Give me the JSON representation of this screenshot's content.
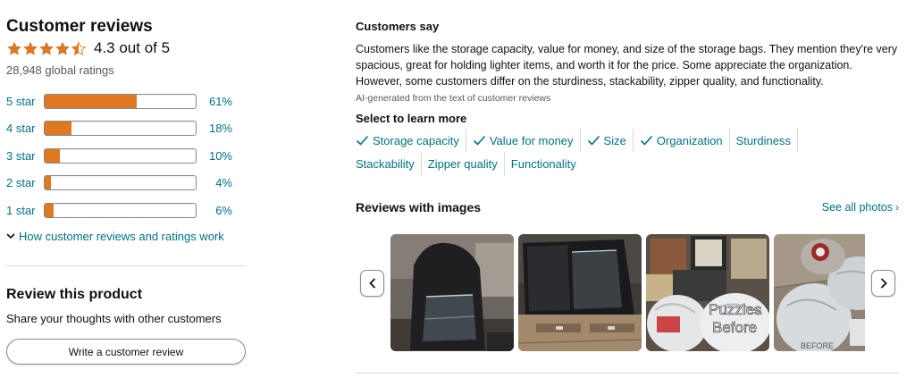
{
  "reviews": {
    "title": "Customer reviews",
    "rating_value": 4.3,
    "rating_text": "4.3 out of 5",
    "global_ratings": "28,948 global ratings",
    "histogram": [
      {
        "label": "5 star",
        "percent": 61,
        "percent_text": "61%"
      },
      {
        "label": "4 star",
        "percent": 18,
        "percent_text": "18%"
      },
      {
        "label": "3 star",
        "percent": 10,
        "percent_text": "10%"
      },
      {
        "label": "2 star",
        "percent": 4,
        "percent_text": "4%"
      },
      {
        "label": "1 star",
        "percent": 6,
        "percent_text": "6%"
      }
    ],
    "how_link": "How customer reviews and ratings work"
  },
  "review_product": {
    "title": "Review this product",
    "subtitle": "Share your thoughts with other customers",
    "button": "Write a customer review"
  },
  "customers_say": {
    "title": "Customers say",
    "summary": "Customers like the storage capacity, value for money, and size of the storage bags. They mention they're very spacious, great for holding lighter items, and worth it for the price. Some appreciate the organization. However, some customers differ on the sturdiness, stackability, zipper quality, and functionality.",
    "ai_note": "AI-generated from the text of customer reviews",
    "learn_more": "Select to learn more",
    "chips": [
      {
        "label": "Storage capacity",
        "positive": true
      },
      {
        "label": "Value for money",
        "positive": true
      },
      {
        "label": "Size",
        "positive": true
      },
      {
        "label": "Organization",
        "positive": true
      },
      {
        "label": "Sturdiness",
        "positive": false
      },
      {
        "label": "Stackability",
        "positive": false
      },
      {
        "label": "Zipper quality",
        "positive": false
      },
      {
        "label": "Functionality",
        "positive": false
      }
    ]
  },
  "reviews_with_images": {
    "title": "Reviews with images",
    "see_all": "See all photos",
    "thumb_captions": [
      "Puzzles",
      "Before",
      "BEFORE"
    ]
  },
  "colors": {
    "accent_orange": "#de7921",
    "link_teal": "#007185",
    "text": "#0f1111",
    "muted": "#565959"
  },
  "icons": {
    "star": "star-icon",
    "check": "check-icon",
    "chevron_down": "chevron-down-icon",
    "chevron_left": "chevron-left-icon",
    "chevron_right": "chevron-right-icon"
  }
}
